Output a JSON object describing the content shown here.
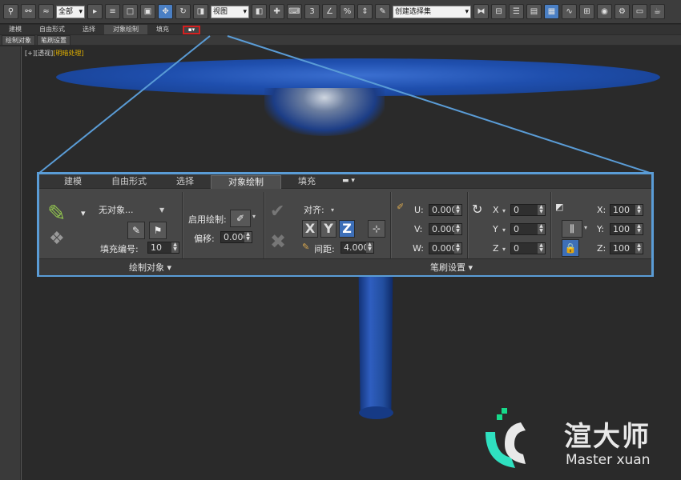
{
  "toolbar": {
    "selection_filter": "全部",
    "ref_coord": "视图",
    "named_selection": "创建选择集",
    "icons": [
      "link-icon",
      "unlink-icon",
      "bind-spacewarp-icon",
      "select-object-icon",
      "select-by-name-icon",
      "rect-region-icon",
      "window-crossing-icon",
      "move-icon",
      "rotate-icon",
      "scale-icon",
      "snap-3d-icon",
      "angle-snap-icon",
      "percent-snap-icon",
      "spinner-snap-icon",
      "edit-named-sel-icon",
      "mirror-icon",
      "align-icon",
      "layer-icon",
      "graphite-icon",
      "curve-editor-icon",
      "schematic-icon",
      "material-editor-icon",
      "render-setup-icon",
      "rendered-frame-icon",
      "render-icon"
    ]
  },
  "ribbon_small": {
    "tabs": [
      "建模",
      "自由形式",
      "选择",
      "对象绘制",
      "填充"
    ],
    "active_tab": "对象绘制",
    "subtabs": [
      "绘制对象",
      "笔刷设置"
    ]
  },
  "viewport": {
    "label_plus": "[+]",
    "label_view": "[透视]",
    "label_shading": "[明暗处理]"
  },
  "zoom_panel": {
    "tabs": [
      "建模",
      "自由形式",
      "选择",
      "对象绘制",
      "填充"
    ],
    "active_tab": "对象绘制",
    "paint_objects": {
      "no_object": "无对象...",
      "fill_number_label": "填充编号:",
      "fill_number": "10",
      "enable_paint_label": "启用绘制:",
      "offset_label": "偏移:",
      "offset": "0.000",
      "footer": "绘制对象"
    },
    "brush_settings": {
      "align_label": "对齐:",
      "spacing_label": "间距:",
      "spacing": "4.000",
      "axes": [
        "X",
        "Y",
        "Z"
      ],
      "active_axis": "Z",
      "u_label": "U:",
      "u": "0.000",
      "v_label": "V:",
      "v": "0.000",
      "w_label": "W:",
      "w": "0.000",
      "rx_label": "X",
      "rx": "0",
      "ry_label": "Y",
      "ry": "0",
      "rz_label": "Z",
      "rz": "0",
      "sx_label": "X:",
      "sx": "100",
      "sy_label": "Y:",
      "sy": "100",
      "sz_label": "Z:",
      "sz": "100",
      "footer": "笔刷设置"
    }
  },
  "watermark": {
    "brand": "渲大师",
    "sub": "Master xuan"
  },
  "colors": {
    "accent": "#5a9cd6",
    "model_blue": "#1f4fae",
    "highlight_red": "#d42020"
  }
}
